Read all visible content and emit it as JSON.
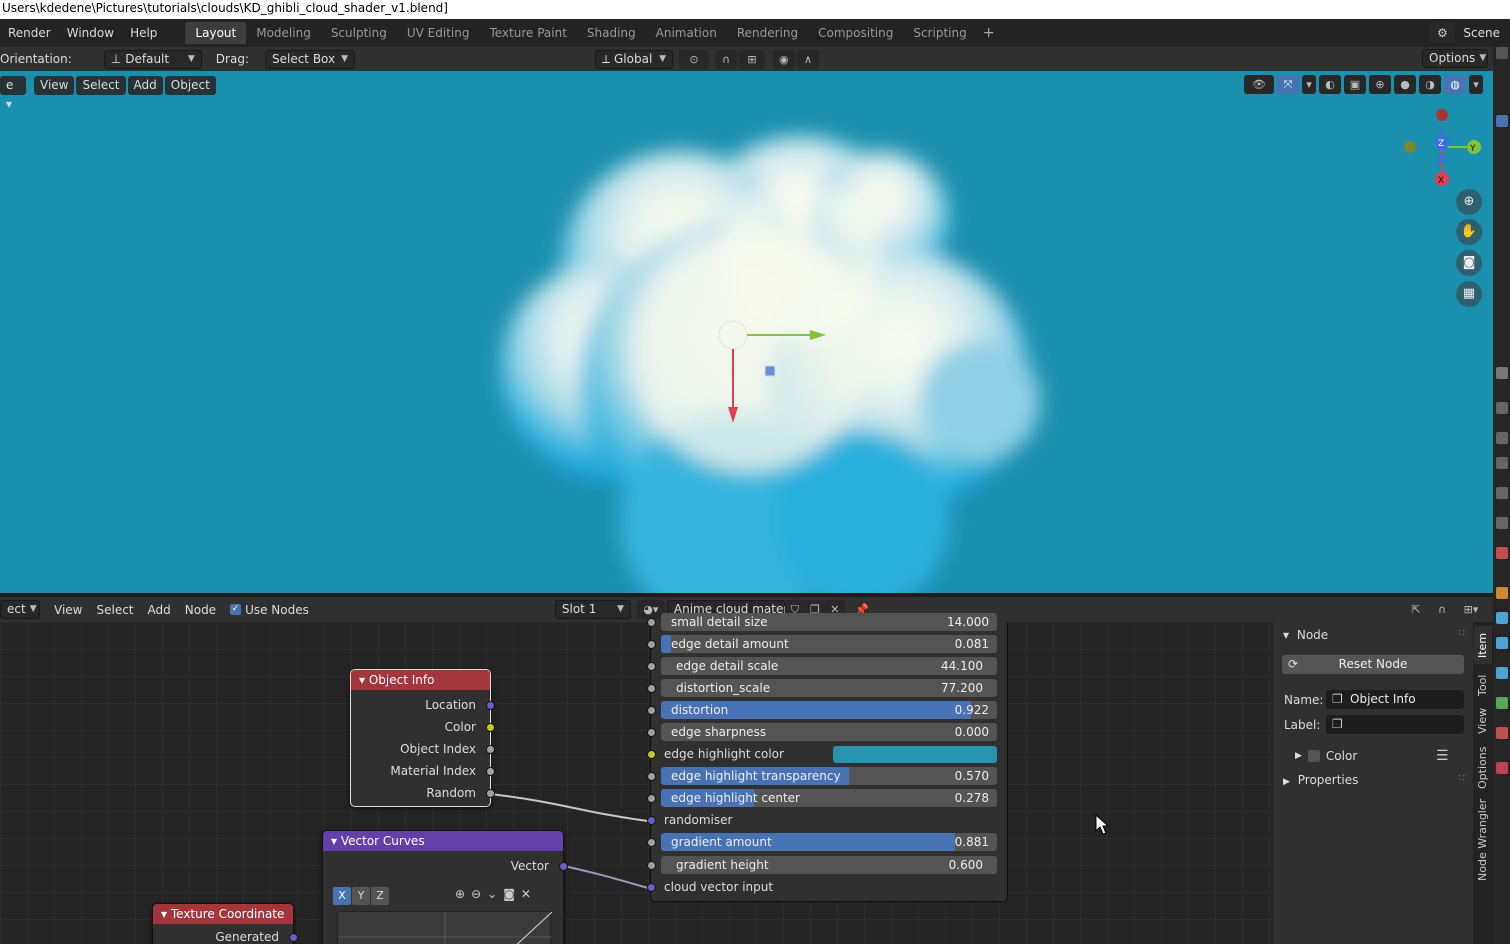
{
  "titlebar": {
    "path": "Users\\kdedene\\Pictures\\tutorials\\clouds\\KD_ghibli_cloud_shader_v1.blend]"
  },
  "menu": [
    "Render",
    "Window",
    "Help"
  ],
  "workspaces": [
    {
      "label": "Layout",
      "active": true
    },
    {
      "label": "Modeling"
    },
    {
      "label": "Sculpting"
    },
    {
      "label": "UV Editing"
    },
    {
      "label": "Texture Paint"
    },
    {
      "label": "Shading"
    },
    {
      "label": "Animation"
    },
    {
      "label": "Rendering"
    },
    {
      "label": "Compositing"
    },
    {
      "label": "Scripting"
    }
  ],
  "workspace_add": "+",
  "scene": {
    "label": "Scene"
  },
  "toolheader": {
    "orientation_label": "Orientation:",
    "orientation_value": "Default",
    "drag_label": "Drag:",
    "drag_value": "Select Box",
    "transform_orientation": "Global",
    "options_label": "Options"
  },
  "viewport": {
    "mode_fragment": "e",
    "menus": [
      "View",
      "Select",
      "Add",
      "Object"
    ],
    "background_color": "#1b8fae"
  },
  "node_editor": {
    "type_fragment": "ect",
    "menus": [
      "View",
      "Select",
      "Add",
      "Node"
    ],
    "use_nodes_label": "Use Nodes",
    "use_nodes_checked": true,
    "slot": "Slot 1",
    "material_name": "Anime cloud materi..."
  },
  "nodes": {
    "object_info": {
      "title": "Object Info",
      "outputs": [
        "Location",
        "Color",
        "Object Index",
        "Material Index",
        "Random"
      ]
    },
    "vector_curves": {
      "title": "Vector Curves",
      "output": "Vector",
      "channels": [
        "X",
        "Y",
        "Z"
      ]
    },
    "texture_coordinate": {
      "title": "Texture Coordinate",
      "output": "Generated"
    }
  },
  "group_inputs": [
    {
      "label": "small detail size",
      "value": "14.000",
      "fill": 0,
      "partial": true
    },
    {
      "label": "edge detail amount",
      "value": "0.081",
      "fill": 0.03
    },
    {
      "label": "edge detail scale",
      "value": "44.100",
      "fill": 0
    },
    {
      "label": "distortion_scale",
      "value": "77.200",
      "fill": 0
    },
    {
      "label": "distortion",
      "value": "0.922",
      "fill": 0.922
    },
    {
      "label": "edge sharpness",
      "value": "0.000",
      "fill": 0
    },
    {
      "label": "edge highlight color",
      "color": "#2794ad",
      "type": "color"
    },
    {
      "label": "edge highlight transparency",
      "value": "0.570",
      "fill": 0.57
    },
    {
      "label": "edge highlight center",
      "value": "0.278",
      "fill": 0.278
    },
    {
      "label": "randomiser",
      "type": "socket"
    },
    {
      "label": "gradient amount",
      "value": "0.881",
      "fill": 0.881
    },
    {
      "label": "gradient height",
      "value": "0.600",
      "fill": 0
    },
    {
      "label": "cloud vector input",
      "type": "socket"
    }
  ],
  "sidebar": {
    "node_section": "Node",
    "reset_button": "Reset Node",
    "name_label": "Name:",
    "name_value": "Object Info",
    "label_label": "Label:",
    "label_value": "",
    "color_label": "Color",
    "properties_label": "Properties",
    "tabs": [
      "Item",
      "Tool",
      "View",
      "Options",
      "Node Wrangler"
    ]
  }
}
